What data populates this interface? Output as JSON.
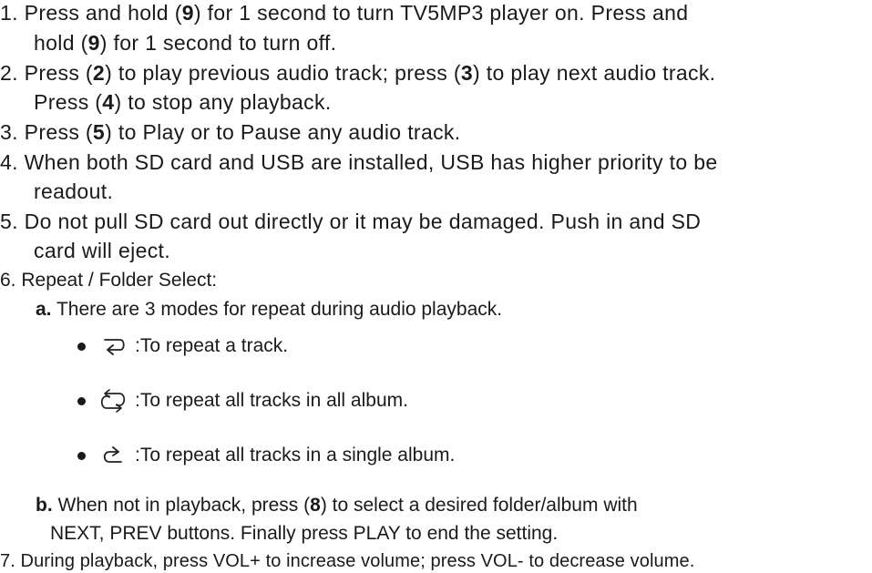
{
  "items": {
    "i1": {
      "l1a": "1. Press and hold (",
      "k1": "9",
      "l1b": ") for 1 second to turn TV5MP3  player on. Press and",
      "l2a": "hold (",
      "k2": "9",
      "l2b": ") for 1 second to turn off."
    },
    "i2": {
      "l1a": "2. Press (",
      "k1": "2",
      "l1b": ") to play previous audio track; press (",
      "k2": "3",
      "l1c": ") to play next audio track.",
      "l2a": "Press (",
      "k3": "4",
      "l2b": ") to stop any playback."
    },
    "i3": {
      "a": "3. Press (",
      "k": "5",
      "b": ") to Play or to Pause any audio track."
    },
    "i4": {
      "l1": "4. When both SD card and USB are installed, USB has higher priority to be",
      "l2": "readout."
    },
    "i5": {
      "l1": "5. Do not pull SD card out directly or it may be damaged. Push in and SD",
      "l2": "card will eject."
    },
    "i6": {
      "title": "6. Repeat / Folder Select:",
      "a_label": "a.",
      "a_text": " There are 3 modes for repeat during audio playback.",
      "modes": [
        {
          "icon": "repeat-one-icon",
          "text": ":To repeat a track."
        },
        {
          "icon": "repeat-all-icon",
          "text": ":To repeat all tracks in all album."
        },
        {
          "icon": "repeat-album-icon",
          "text": ":To repeat all tracks in a single album."
        }
      ],
      "b_label": "b.",
      "b_l1a": " When not in playback, press (",
      "b_k": "8",
      "b_l1b": ") to select a desired folder/album with",
      "b_l2": "NEXT,  PREV buttons. Finally press PLAY to end the setting."
    },
    "i7": "7. During playback, press VOL+ to increase volume; press VOL- to decrease volume."
  }
}
